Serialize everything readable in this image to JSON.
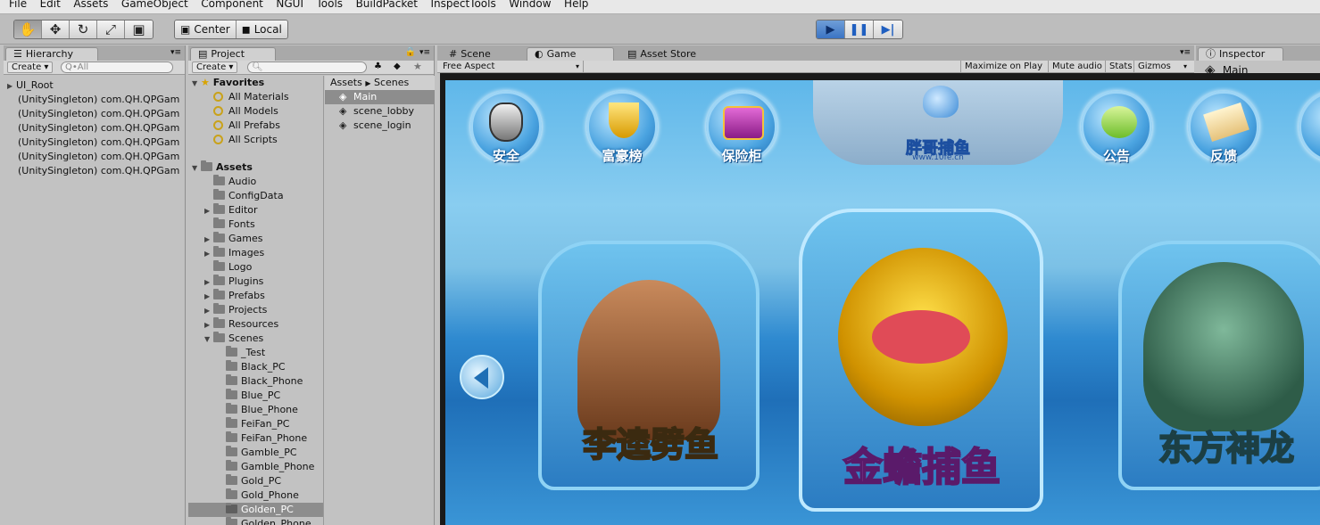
{
  "menu": [
    "File",
    "Edit",
    "Assets",
    "GameObject",
    "Component",
    "NGUI",
    "Tools",
    "BuildPacket",
    "InspectTools",
    "Window",
    "Help"
  ],
  "toolbar": {
    "pivot_center": "Center",
    "pivot_local": "Local"
  },
  "hierarchy": {
    "tab": "Hierarchy",
    "create": "Create",
    "search_placeholder": "Q•All",
    "items": [
      "UI_Root",
      "(UnitySingleton) com.QH.QPGam",
      "(UnitySingleton) com.QH.QPGam",
      "(UnitySingleton) com.QH.QPGam",
      "(UnitySingleton) com.QH.QPGam",
      "(UnitySingleton) com.QH.QPGam",
      "(UnitySingleton) com.QH.QPGam"
    ]
  },
  "project": {
    "tab": "Project",
    "create": "Create",
    "favorites_label": "Favorites",
    "favorites": [
      "All Materials",
      "All Models",
      "All Prefabs",
      "All Scripts"
    ],
    "assets_label": "Assets",
    "folders": [
      "Audio",
      "ConfigData",
      "Editor",
      "Fonts",
      "Games",
      "Images",
      "Logo",
      "Plugins",
      "Prefabs",
      "Projects",
      "Resources",
      "Scenes"
    ],
    "scene_folders": [
      "_Test",
      "Black_PC",
      "Black_Phone",
      "Blue_PC",
      "Blue_Phone",
      "FeiFan_PC",
      "FeiFan_Phone",
      "Gamble_PC",
      "Gamble_Phone",
      "Gold_PC",
      "Gold_Phone",
      "Golden_PC",
      "Golden_Phone"
    ],
    "selected_folder": "Golden_PC",
    "breadcrumb": [
      "Assets",
      "Scenes"
    ],
    "scene_files": [
      "Main",
      "scene_lobby",
      "scene_login"
    ]
  },
  "scene_tabs": {
    "scene": "Scene",
    "game": "Game",
    "asset_store": "Asset Store"
  },
  "game_bar": {
    "aspect": "Free Aspect",
    "maximize": "Maximize on Play",
    "mute": "Mute audio",
    "stats": "Stats",
    "gizmos": "Gizmos"
  },
  "inspector": {
    "tab": "Inspector",
    "object": "Main"
  },
  "game": {
    "logo_text": "胖哥捕鱼",
    "logo_url": "www.10fe.cn",
    "top_buttons": [
      "安全",
      "富豪榜",
      "保险柜",
      "公告",
      "反馈"
    ],
    "cards": [
      "李逵劈鱼",
      "金蟾捕鱼",
      "东方神龙"
    ]
  }
}
